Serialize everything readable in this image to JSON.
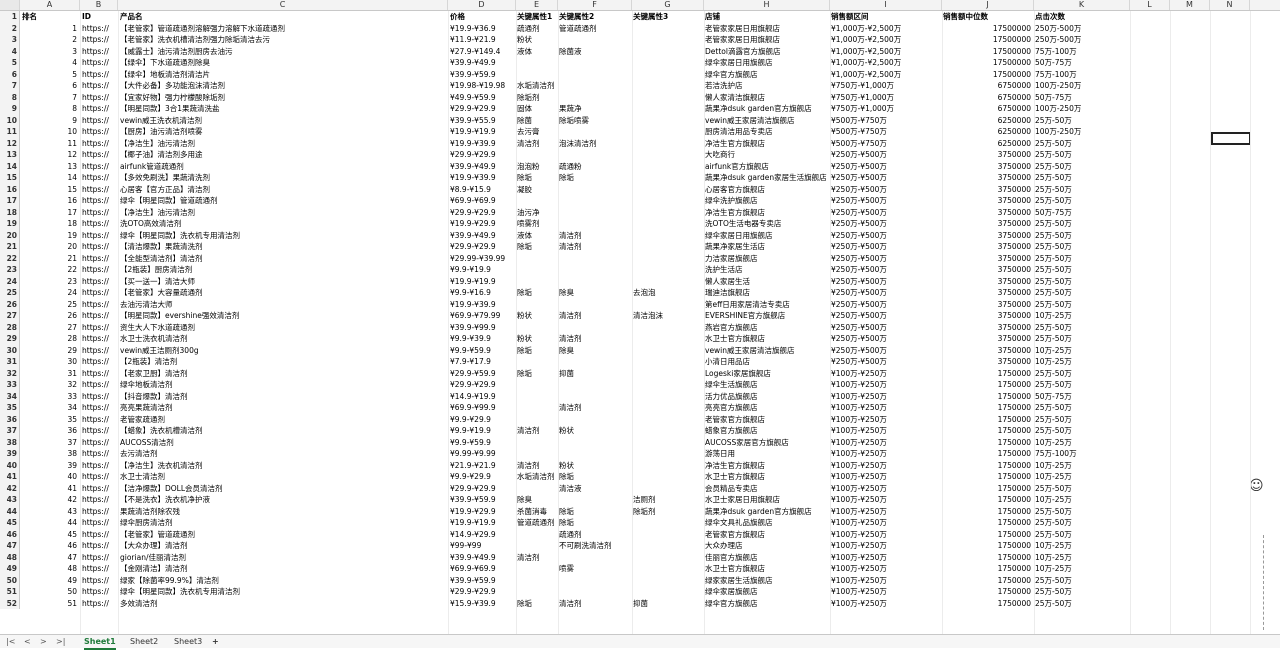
{
  "columns": [
    "A",
    "B",
    "C",
    "D",
    "E",
    "F",
    "G",
    "H",
    "I",
    "J",
    "K",
    "L",
    "M",
    "N"
  ],
  "headers": [
    "排名",
    "ID",
    "产品名",
    "价格",
    "关键属性1",
    "关键属性2",
    "关键属性3",
    "店铺",
    "销售额区间",
    "销售额中位数",
    "点击次数"
  ],
  "rows": [
    [
      "1",
      "https://",
      "【老管家】管道疏通剂溶解强力溶解下水道疏通剂",
      "¥19.9-¥36.9",
      "疏通剂",
      "管道疏通剂",
      "",
      "老管家家居日用旗舰店",
      "¥1,000万-¥2,500万",
      "17500000",
      "250万-500万"
    ],
    [
      "2",
      "https://",
      "【老管家】洗衣机槽清洁剂强力除垢清洁去污",
      "¥11.9-¥21.9",
      "粉状",
      "",
      "",
      "老管家家居日用旗舰店",
      "¥1,000万-¥2,500万",
      "17500000",
      "250万-500万"
    ],
    [
      "3",
      "https://",
      "【威露士】油污清洁剂厨房去油污",
      "¥27.9-¥149.4",
      "液体",
      "除菌液",
      "",
      "Dettol滴露官方旗舰店",
      "¥1,000万-¥2,500万",
      "17500000",
      "75万-100万"
    ],
    [
      "4",
      "https://",
      "【绿伞】下水道疏通剂除臭",
      "¥39.9-¥49.9",
      "",
      "",
      "",
      "绿伞家居日用旗舰店",
      "¥1,000万-¥2,500万",
      "17500000",
      "50万-75万"
    ],
    [
      "5",
      "https://",
      "【绿伞】地板清洁剂清洁片",
      "¥39.9-¥59.9",
      "",
      "",
      "",
      "绿伞官方旗舰店",
      "¥1,000万-¥2,500万",
      "17500000",
      "75万-100万"
    ],
    [
      "6",
      "https://",
      "【大件必备】多功能泡沫清洁剂",
      "¥19.98-¥19.98",
      "水垢清洁剂",
      "",
      "",
      "若洁洗护店",
      "¥750万-¥1,000万",
      "6750000",
      "100万-250万"
    ],
    [
      "7",
      "https://",
      "【宜家好物】强力柠檬酸除垢剂",
      "¥49.9-¥59.9",
      "除垢剂",
      "",
      "",
      "懒人家清洁旗舰店",
      "¥750万-¥1,000万",
      "6750000",
      "50万-75万"
    ],
    [
      "8",
      "https://",
      "【明星同款】3合1果蔬清洗盐",
      "¥29.9-¥29.9",
      "固体",
      "果蔬净",
      "",
      "蔬果净dsuk garden官方旗舰店",
      "¥750万-¥1,000万",
      "6750000",
      "100万-250万"
    ],
    [
      "9",
      "https://",
      "vewin威王洗衣机清洁剂",
      "¥39.9-¥55.9",
      "除菌",
      "除垢喷雾",
      "",
      "vewin威王家居清洁旗舰店",
      "¥500万-¥750万",
      "6250000",
      "25万-50万"
    ],
    [
      "10",
      "https://",
      "【厨房】油污清洁剂喷雾",
      "¥19.9-¥19.9",
      "去污膏",
      "",
      "",
      "厨房清洁用品专卖店",
      "¥500万-¥750万",
      "6250000",
      "100万-250万"
    ],
    [
      "11",
      "https://",
      "【净洁生】油污清洁剂",
      "¥19.9-¥39.9",
      "清洁剂",
      "泡沫清洁剂",
      "",
      "净洁生官方旗舰店",
      "¥500万-¥750万",
      "6250000",
      "25万-50万"
    ],
    [
      "12",
      "https://",
      "【椰子油】清洁剂多用途",
      "¥29.9-¥29.9",
      "",
      "",
      "",
      "大吃商行",
      "¥250万-¥500万",
      "3750000",
      "25万-50万"
    ],
    [
      "13",
      "https://",
      "airfunk管道疏通剂",
      "¥39.9-¥49.9",
      "泡泡粉",
      "疏通粉",
      "",
      "airfunk官方旗舰店",
      "¥250万-¥500万",
      "3750000",
      "25万-50万"
    ],
    [
      "14",
      "https://",
      "【多效免刷洗】果蔬清洗剂",
      "¥19.9-¥39.9",
      "除垢",
      "除垢",
      "",
      "蔬果净dsuk garden家居生活旗舰店",
      "¥250万-¥500万",
      "3750000",
      "25万-50万"
    ],
    [
      "15",
      "https://",
      "心居客【官方正品】清洁剂",
      "¥8.9-¥15.9",
      "凝胶",
      "",
      "",
      "心居客官方旗舰店",
      "¥250万-¥500万",
      "3750000",
      "25万-50万"
    ],
    [
      "16",
      "https://",
      "绿伞【明星同款】管道疏通剂",
      "¥69.9-¥69.9",
      "",
      "",
      "",
      "绿伞洗护旗舰店",
      "¥250万-¥500万",
      "3750000",
      "25万-50万"
    ],
    [
      "17",
      "https://",
      "【净洁生】油污清洁剂",
      "¥29.9-¥29.9",
      "油污净",
      "",
      "",
      "净洁生官方旗舰店",
      "¥250万-¥500万",
      "3750000",
      "50万-75万"
    ],
    [
      "18",
      "https://",
      "洗OTO高效清洁剂",
      "¥19.9-¥29.9",
      "喷雾剂",
      "",
      "",
      "洗OTO生活电器专卖店",
      "¥250万-¥500万",
      "3750000",
      "25万-50万"
    ],
    [
      "19",
      "https://",
      "绿伞【明星同款】洗衣机专用清洁剂",
      "¥39.9-¥49.9",
      "液体",
      "清洁剂",
      "",
      "绿伞家居日用旗舰店",
      "¥250万-¥500万",
      "3750000",
      "25万-50万"
    ],
    [
      "20",
      "https://",
      "【清洁爆款】果蔬清洗剂",
      "¥29.9-¥29.9",
      "除垢",
      "清洁剂",
      "",
      "蔬果净家居生活店",
      "¥250万-¥500万",
      "3750000",
      "25万-50万"
    ],
    [
      "21",
      "https://",
      "【全能型清洁剂】清洁剂",
      "¥29.99-¥39.99",
      "",
      "",
      "",
      "力洁家居旗舰店",
      "¥250万-¥500万",
      "3750000",
      "25万-50万"
    ],
    [
      "22",
      "https://",
      "【2瓶装】厨房清洁剂",
      "¥9.9-¥19.9",
      "",
      "",
      "",
      "洗护生活店",
      "¥250万-¥500万",
      "3750000",
      "25万-50万"
    ],
    [
      "23",
      "https://",
      "【买一送一】清洁大师",
      "¥19.9-¥19.9",
      "",
      "",
      "",
      "懒人家居生活",
      "¥250万-¥500万",
      "3750000",
      "25万-50万"
    ],
    [
      "24",
      "https://",
      "【老管家】大容量疏通剂",
      "¥9.9-¥16.9",
      "除垢",
      "除臭",
      "去泡泡",
      "瑞迪洁旗舰店",
      "¥250万-¥500万",
      "3750000",
      "25万-50万"
    ],
    [
      "25",
      "https://",
      "去油污清洁大师",
      "¥19.9-¥39.9",
      "",
      "",
      "",
      "第eff日用家居清洁专卖店",
      "¥250万-¥500万",
      "3750000",
      "25万-50万"
    ],
    [
      "26",
      "https://",
      "【明星同款】evershine强效清洁剂",
      "¥69.9-¥79.99",
      "粉状",
      "清洁剂",
      "清洁泡沫",
      "EVERSHINE官方旗舰店",
      "¥250万-¥500万",
      "3750000",
      "10万-25万"
    ],
    [
      "27",
      "https://",
      "资生大人下水道疏通剂",
      "¥39.9-¥99.9",
      "",
      "",
      "",
      "燕岩官方旗舰店",
      "¥250万-¥500万",
      "3750000",
      "25万-50万"
    ],
    [
      "28",
      "https://",
      "水卫士洗衣机清洁剂",
      "¥9.9-¥39.9",
      "粉状",
      "清洁剂",
      "",
      "水卫士官方旗舰店",
      "¥250万-¥500万",
      "3750000",
      "25万-50万"
    ],
    [
      "29",
      "https://",
      "vewin威王洁厕剂300g",
      "¥9.9-¥59.9",
      "除垢",
      "除臭",
      "",
      "vewin威王家居清洁旗舰店",
      "¥250万-¥500万",
      "3750000",
      "10万-25万"
    ],
    [
      "30",
      "https://",
      "【2瓶装】清洁剂",
      "¥7.9-¥17.9",
      "",
      "",
      "",
      "小清日用品店",
      "¥250万-¥500万",
      "3750000",
      "10万-25万"
    ],
    [
      "31",
      "https://",
      "【老家卫厨】清洁剂",
      "¥29.9-¥59.9",
      "除垢",
      "抑菌",
      "",
      "Logeski家居旗舰店",
      "¥100万-¥250万",
      "1750000",
      "25万-50万"
    ],
    [
      "32",
      "https://",
      "绿伞地板清洁剂",
      "¥29.9-¥29.9",
      "",
      "",
      "",
      "绿伞生活旗舰店",
      "¥100万-¥250万",
      "1750000",
      "25万-50万"
    ],
    [
      "33",
      "https://",
      "【抖音爆款】清洁剂",
      "¥14.9-¥19.9",
      "",
      "",
      "",
      "活力优品旗舰店",
      "¥100万-¥250万",
      "1750000",
      "50万-75万"
    ],
    [
      "34",
      "https://",
      "亮亮果蔬清洁剂",
      "¥69.9-¥99.9",
      "",
      "清洁剂",
      "",
      "亮亮官方旗舰店",
      "¥100万-¥250万",
      "1750000",
      "25万-50万"
    ],
    [
      "35",
      "https://",
      "老管家疏通剂",
      "¥9.9-¥29.9",
      "",
      "",
      "",
      "老管家官方旗舰店",
      "¥100万-¥250万",
      "1750000",
      "25万-50万"
    ],
    [
      "36",
      "https://",
      "【蜡象】洗衣机槽清洁剂",
      "¥9.9-¥19.9",
      "清洁剂",
      "粉状",
      "",
      "蜡象官方旗舰店",
      "¥100万-¥250万",
      "1750000",
      "25万-50万"
    ],
    [
      "37",
      "https://",
      "AUCOSS清洁剂",
      "¥9.9-¥59.9",
      "",
      "",
      "",
      "AUCOSS家居官方旗舰店",
      "¥100万-¥250万",
      "1750000",
      "10万-25万"
    ],
    [
      "38",
      "https://",
      "去污清洁剂",
      "¥9.99-¥9.99",
      "",
      "",
      "",
      "游荡日用",
      "¥100万-¥250万",
      "1750000",
      "75万-100万"
    ],
    [
      "39",
      "https://",
      "【净洁生】洗衣机清洁剂",
      "¥21.9-¥21.9",
      "清洁剂",
      "粉状",
      "",
      "净洁生官方旗舰店",
      "¥100万-¥250万",
      "1750000",
      "10万-25万"
    ],
    [
      "40",
      "https://",
      "水卫士清洁剂",
      "¥9.9-¥29.9",
      "水垢清洁剂",
      "除垢",
      "",
      "水卫士官方旗舰店",
      "¥100万-¥250万",
      "1750000",
      "10万-25万"
    ],
    [
      "41",
      "https://",
      "【洁净爆款】DOLL会员清洁剂",
      "¥29.9-¥29.9",
      "",
      "清洁液",
      "",
      "会员精品专卖店",
      "¥100万-¥250万",
      "1750000",
      "25万-50万"
    ],
    [
      "42",
      "https://",
      "【不是洗衣】洗衣机净护液",
      "¥39.9-¥59.9",
      "除臭",
      "",
      "洁厕剂",
      "水卫士家居日用旗舰店",
      "¥100万-¥250万",
      "1750000",
      "10万-25万"
    ],
    [
      "43",
      "https://",
      "果蔬清洁剂除农残",
      "¥19.9-¥29.9",
      "杀菌消毒",
      "除垢",
      "除垢剂",
      "蔬果净dsuk garden官方旗舰店",
      "¥100万-¥250万",
      "1750000",
      "25万-50万"
    ],
    [
      "44",
      "https://",
      "绿伞厨房清洁剂",
      "¥19.9-¥19.9",
      "管道疏通剂",
      "除垢",
      "",
      "绿伞文具礼品旗舰店",
      "¥100万-¥250万",
      "1750000",
      "25万-50万"
    ],
    [
      "45",
      "https://",
      "【老管家】管道疏通剂",
      "¥14.9-¥29.9",
      "",
      "疏通剂",
      "",
      "老管家官方旗舰店",
      "¥100万-¥250万",
      "1750000",
      "25万-50万"
    ],
    [
      "46",
      "https://",
      "【大众办理】清洁剂",
      "¥99-¥99",
      "",
      "不可刷洗清洁剂",
      "",
      "大众办理店",
      "¥100万-¥250万",
      "1750000",
      "10万-25万"
    ],
    [
      "47",
      "https://",
      "giorian/佳丽清洁剂",
      "¥39.9-¥49.9",
      "清洁剂",
      "",
      "",
      "佳丽官方旗舰店",
      "¥100万-¥250万",
      "1750000",
      "10万-25万"
    ],
    [
      "48",
      "https://",
      "【金刚清洁】清洁剂",
      "¥69.9-¥69.9",
      "",
      "喷雾",
      "",
      "水卫士官方旗舰店",
      "¥100万-¥250万",
      "1750000",
      "10万-25万"
    ],
    [
      "49",
      "https://",
      "绿家【除菌率99.9%】清洁剂",
      "¥39.9-¥59.9",
      "",
      "",
      "",
      "绿家家居生活旗舰店",
      "¥100万-¥250万",
      "1750000",
      "25万-50万"
    ],
    [
      "50",
      "https://",
      "绿伞【明星同款】洗衣机专用清洁剂",
      "¥29.9-¥29.9",
      "",
      "",
      "",
      "绿伞家居旗舰店",
      "¥100万-¥250万",
      "1750000",
      "25万-50万"
    ],
    [
      "51",
      "https://",
      "多效清洁剂",
      "¥15.9-¥39.9",
      "除垢",
      "清洁剂",
      "抑菌",
      "绿伞官方旗舰店",
      "¥100万-¥250万",
      "1750000",
      "25万-50万"
    ]
  ],
  "tabs": [
    "Sheet1",
    "Sheet2",
    "Sheet3"
  ],
  "nav": [
    "|<",
    "<",
    ">",
    ">|"
  ],
  "add_sheet": "+"
}
